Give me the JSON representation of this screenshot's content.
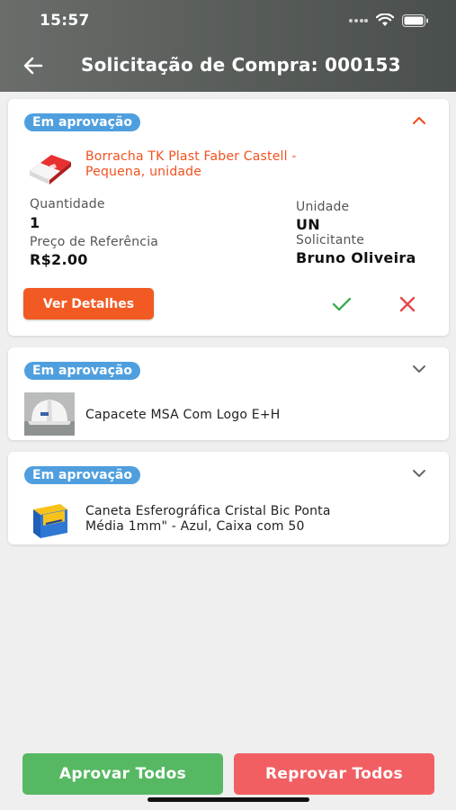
{
  "status_bar": {
    "time": "15:57"
  },
  "header": {
    "title": "Solicitação de Compra: 000153"
  },
  "colors": {
    "accent": "#f25a23",
    "badge": "#4f9fdf",
    "approve": "#56b863",
    "reject": "#f25f63"
  },
  "items": [
    {
      "status": "Em aprovação",
      "name_line1": "Borracha TK Plast Faber Castell -",
      "name_line2": "Pequena, unidade",
      "expanded": true,
      "thumbnail": "eraser-image",
      "quantity_label": "Quantidade",
      "quantity": "1",
      "unit_label": "Unidade",
      "unit": "UN",
      "price_label": "Preço de Referência",
      "price": "R$2.00",
      "requester_label": "Solicitante",
      "requester": "Bruno Oliveira",
      "details_button": "Ver Detalhes"
    },
    {
      "status": "Em aprovação",
      "name_line1": "Capacete MSA Com Logo E+H",
      "expanded": false,
      "thumbnail": "helmet-image"
    },
    {
      "status": "Em aprovação",
      "name_line1": "Caneta Esferográfica Cristal Bic Ponta",
      "name_line2": "Média 1mm\" - Azul, Caixa com 50",
      "expanded": false,
      "thumbnail": "pen-box-image"
    }
  ],
  "footer": {
    "approve_all": "Aprovar Todos",
    "reject_all": "Reprovar Todos"
  }
}
